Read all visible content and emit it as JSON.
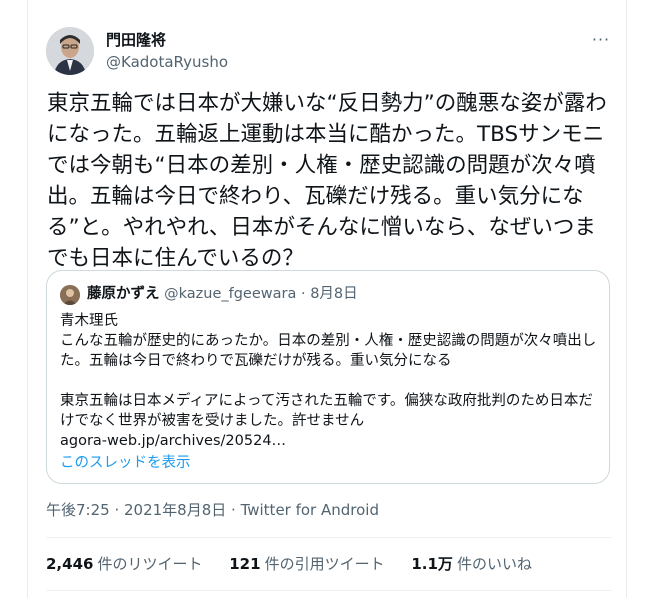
{
  "tweet": {
    "display_name": "門田隆将",
    "handle": "@KadotaRyusho",
    "more_label": "···",
    "text": "東京五輪では日本が大嫌いな“反日勢力”の醜悪な姿が露わになった。五輪返上運動は本当に酷かった。TBSサンモニでは今朝も“日本の差別・人権・歴史認識の問題が次々噴出。五輪は今日で終わり、瓦礫だけ残る。重い気分になる”と。やれやれ、日本がそんなに憎いなら、なぜいつまでも日本に住んでいるの？",
    "timestamp": "午後7:25 · 2021年8月8日",
    "separator": " · ",
    "source": "Twitter for Android"
  },
  "quote": {
    "display_name": "藤原かずえ",
    "handle": "@kazue_fgeewara",
    "dot": " · ",
    "date": "8月8日",
    "body": "青木理氏\nこんな五輪が歴史的にあったか。日本の差別・人権・歴史認識の問題が次々噴出した。五輪は今日で終わりで瓦礫だけが残る。重い気分になる\n\n東京五輪は日本メディアによって汚された五輪です。偏狭な政府批判のため日本だけでなく世界が被害を受けました。許せません\nagora-web.jp/archives/20524…",
    "show_thread": "このスレッドを表示"
  },
  "stats": {
    "retweets_count": "2,446",
    "retweets_label": "件のリツイート",
    "quotes_count": "121",
    "quotes_label": "件の引用ツイート",
    "likes_count": "1.1万",
    "likes_label": "件のいいね"
  },
  "colors": {
    "text": "#0f1419",
    "secondary": "#536471",
    "link": "#1d9bf0",
    "border": "#cfd9de"
  }
}
